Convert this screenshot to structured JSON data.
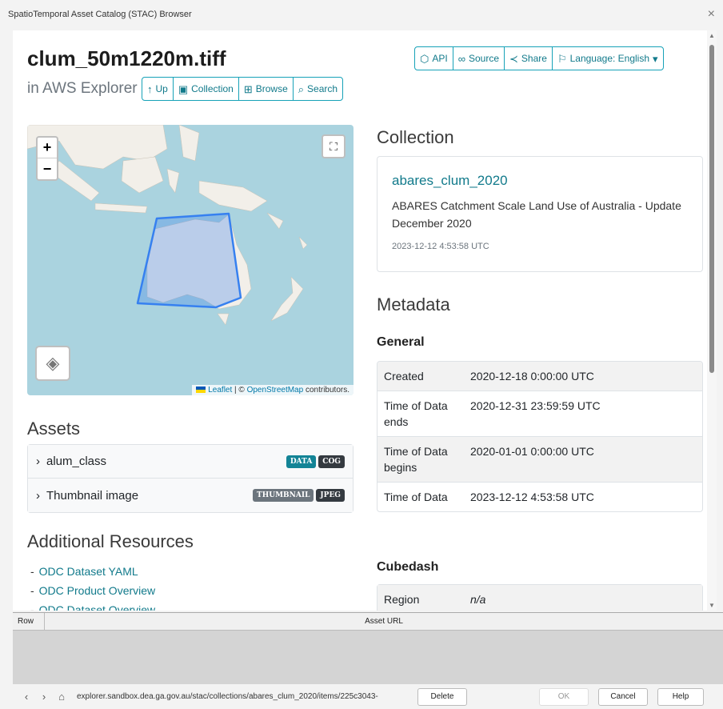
{
  "window": {
    "title": "SpatioTemporal Asset Catalog (STAC) Browser",
    "close": "×"
  },
  "header": {
    "item_title": "clum_50m1220m.tiff",
    "in_text": "in AWS Explorer",
    "nav": {
      "up": "Up",
      "collection": "Collection",
      "browse": "Browse",
      "search": "Search"
    },
    "actions": {
      "api": "API",
      "source": "Source",
      "share": "Share",
      "language": "Language: English"
    }
  },
  "map": {
    "zoom_in": "+",
    "zoom_out": "−",
    "attribution_leaflet": "Leaflet",
    "attribution_sep": " | © ",
    "attribution_osm": "OpenStreetMap",
    "attribution_tail": " contributors."
  },
  "assets": {
    "heading": "Assets",
    "items": [
      {
        "label": "alum_class",
        "badges": [
          "DATA",
          "COG"
        ]
      },
      {
        "label": "Thumbnail image",
        "badges": [
          "THUMBNAIL",
          "JPEG"
        ]
      }
    ]
  },
  "resources": {
    "heading": "Additional Resources",
    "items": [
      "ODC Dataset YAML",
      "ODC Product Overview",
      "ODC Dataset Overview"
    ]
  },
  "collection": {
    "heading": "Collection",
    "id": "abares_clum_2020",
    "description": "ABARES Catchment Scale Land Use of Australia - Update December 2020",
    "date": "2023-12-12 4:53:58 UTC"
  },
  "metadata": {
    "heading": "Metadata",
    "general_heading": "General",
    "rows": [
      {
        "key": "Created",
        "value": "2020-12-18 0:00:00 UTC"
      },
      {
        "key": "Time of Data ends",
        "value": "2020-12-31 23:59:59 UTC"
      },
      {
        "key": "Time of Data begins",
        "value": "2020-01-01 0:00:00 UTC"
      },
      {
        "key": "Time of Data",
        "value": "2023-12-12 4:53:58 UTC"
      }
    ],
    "cubedash_heading": "Cubedash",
    "cubedash_rows": [
      {
        "key": "Region",
        "value": "n/a"
      }
    ]
  },
  "grid": {
    "col_row": "Row",
    "col_url": "Asset URL"
  },
  "statusbar": {
    "url": "explorer.sandbox.dea.ga.gov.au/stac/collections/abares_clum_2020/items/225c3043-",
    "delete": "Delete",
    "ok": "OK",
    "cancel": "Cancel",
    "help": "Help"
  }
}
